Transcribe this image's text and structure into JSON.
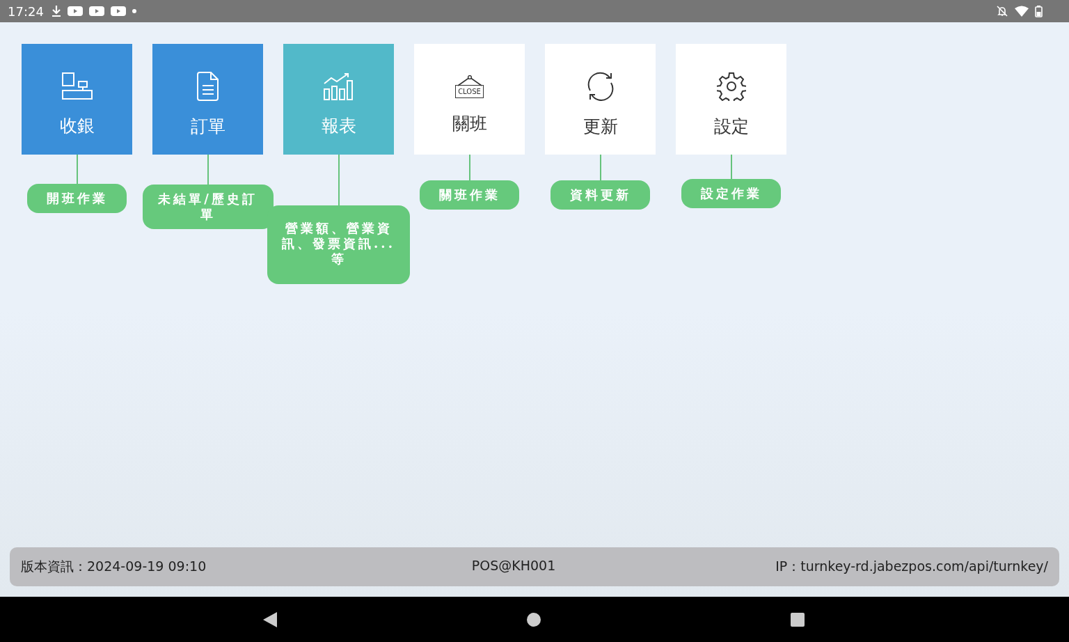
{
  "status_bar": {
    "time": "17:24"
  },
  "tiles": [
    {
      "label": "收銀",
      "color": "#3a8fd9",
      "caption": "開班作業"
    },
    {
      "label": "訂單",
      "color": "#3a8fd9",
      "caption": "未結單/歷史訂單"
    },
    {
      "label": "報表",
      "color": "#52b9c9",
      "caption": "營業額、營業資訊、發票資訊...等"
    },
    {
      "label": "關班",
      "color": "#ffffff",
      "caption": "關班作業",
      "sign_text": "CLOSE"
    },
    {
      "label": "更新",
      "color": "#ffffff",
      "caption": "資料更新"
    },
    {
      "label": "設定",
      "color": "#ffffff",
      "caption": "設定作業"
    }
  ],
  "footer": {
    "version": "版本資訊：2024-09-19 09:10",
    "device": "POS@KH001",
    "ip": "IP：turnkey-rd.jabezpos.com/api/turnkey/"
  }
}
